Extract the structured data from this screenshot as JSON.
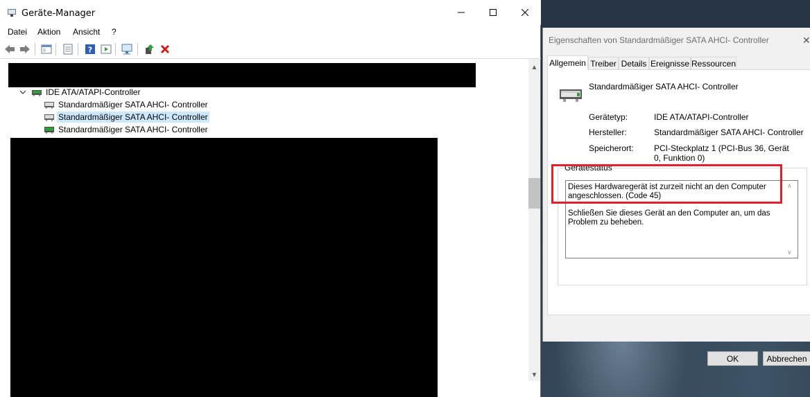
{
  "device_manager": {
    "title": "Geräte-Manager",
    "menu": [
      "Datei",
      "Aktion",
      "Ansicht",
      "?"
    ],
    "tree": {
      "category": "IDE ATA/ATAPI-Controller",
      "items": [
        "Standardmäßiger SATA AHCI- Controller",
        "Standardmäßiger SATA AHCI- Controller",
        "Standardmäßiger SATA AHCI- Controller"
      ],
      "selected_index": 1
    }
  },
  "properties": {
    "title": "Eigenschaften von Standardmäßiger SATA AHCI- Controller",
    "tabs": [
      "Allgemein",
      "Treiber",
      "Details",
      "Ereignisse",
      "Ressourcen"
    ],
    "active_tab": "Allgemein",
    "device_name": "Standardmäßiger SATA AHCI- Controller",
    "fields": {
      "type_label": "Gerätetyp:",
      "type_value": "IDE ATA/ATAPI-Controller",
      "manufacturer_label": "Hersteller:",
      "manufacturer_value": "Standardmäßiger SATA AHCI- Controller",
      "location_label": "Speicherort:",
      "location_value": "PCI-Steckplatz 1 (PCI-Bus 36, Gerät 0, Funktion 0)"
    },
    "status_group_label": "Gerätestatus",
    "status_line1": "Dieses Hardwaregerät ist zurzeit nicht an den Computer angeschlossen. (Code 45)",
    "status_line2": "Schließen Sie dieses Gerät an den Computer an, um das Problem zu beheben.",
    "ok_label": "OK",
    "cancel_label": "Abbrechen"
  },
  "colors": {
    "highlight": "#e0212b",
    "selection": "#cce8ff"
  }
}
